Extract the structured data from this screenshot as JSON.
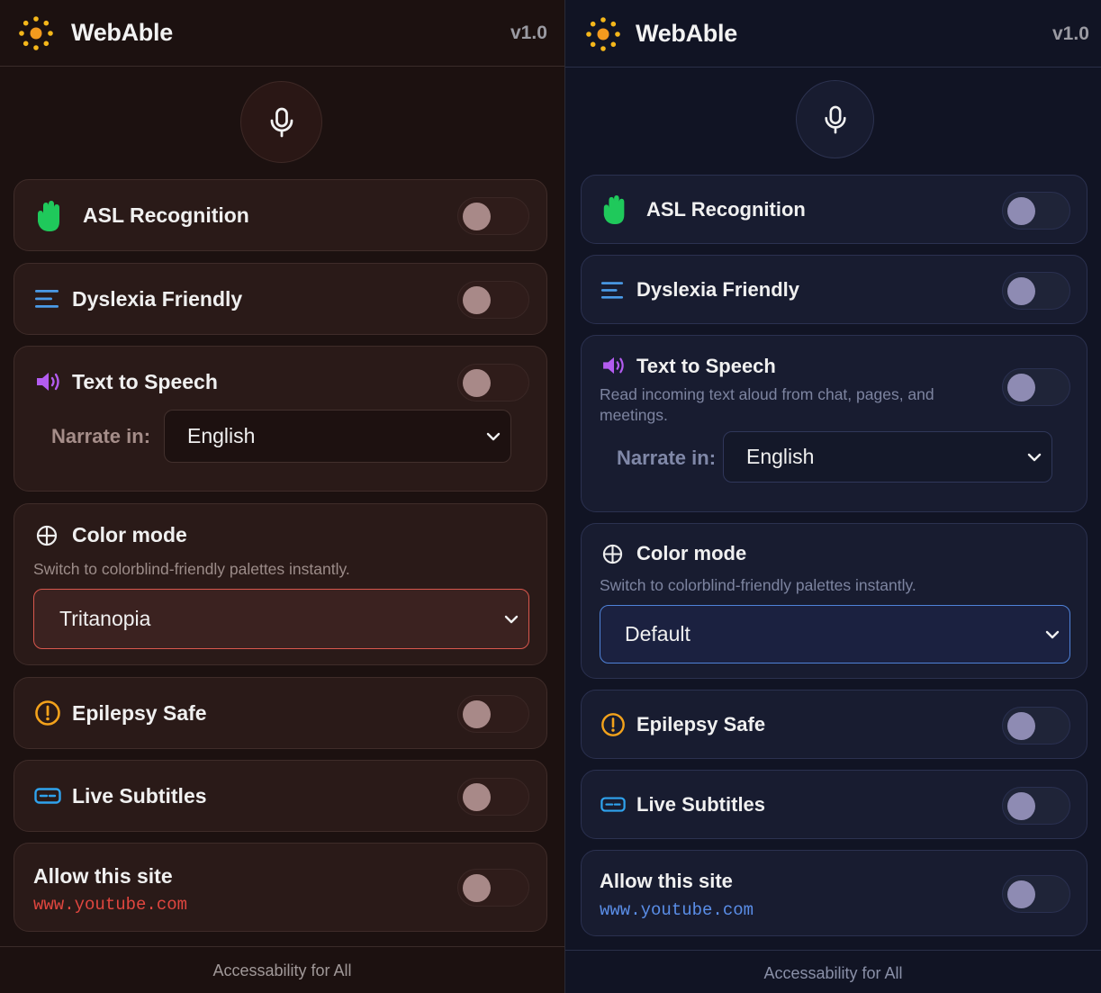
{
  "app": {
    "name": "WebAble",
    "version": "v1.0"
  },
  "features": {
    "asl": {
      "label": "ASL Recognition"
    },
    "dyslexia": {
      "label": "Dyslexia Friendly"
    },
    "tts": {
      "label": "Text to Speech",
      "description": "Read incoming text aloud from chat, pages, and meetings.",
      "narrate_label": "Narrate in:",
      "language": "English"
    },
    "color": {
      "label": "Color mode",
      "description": "Switch to colorblind-friendly palettes instantly."
    },
    "epilepsy": {
      "label": "Epilepsy Safe"
    },
    "subtitles": {
      "label": "Live Subtitles"
    },
    "allow": {
      "label": "Allow this site",
      "domain": "www.youtube.com"
    }
  },
  "themes": {
    "left": {
      "color_mode_value": "Tritanopia",
      "accent": "#e0463f"
    },
    "right": {
      "color_mode_value": "Default",
      "accent": "#5a8ee8"
    }
  },
  "toggle_states": {
    "asl": "off",
    "dyslexia": "off",
    "tts": "off",
    "epilepsy": "off",
    "subtitles": "off",
    "allow_site": "off"
  },
  "icons": {
    "logo": "sun-logo-icon",
    "mic": "microphone-icon",
    "asl": "hand-icon",
    "dyslexia": "lines-icon",
    "tts": "speaker-icon",
    "color": "globe-icon",
    "epilepsy": "alert-circle-icon",
    "subtitles": "subtitles-icon",
    "chevron": "chevron-down-icon"
  },
  "footer": {
    "text": "Accessability for All"
  }
}
